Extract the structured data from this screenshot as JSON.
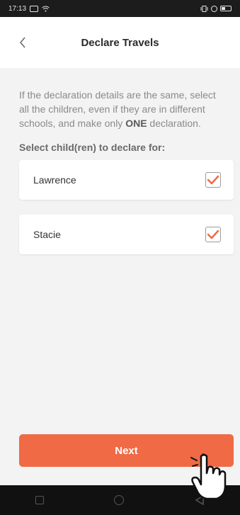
{
  "status_bar": {
    "time": "17:13"
  },
  "header": {
    "title": "Declare Travels"
  },
  "instructions": {
    "text_before": "If the declaration details are the same, select all the children, even if they are in different schools, and make only ",
    "emphasis": "ONE",
    "text_after": " declaration."
  },
  "select_label": "Select child(ren) to declare for:",
  "children": [
    {
      "name": "Lawrence",
      "checked": true
    },
    {
      "name": "Stacie",
      "checked": true
    }
  ],
  "next_button": {
    "label": "Next"
  },
  "colors": {
    "accent": "#ef6a45",
    "background": "#f3f3f3",
    "checkmark": "#ef6a45"
  },
  "icons": {
    "back": "chevron-left-icon",
    "checkbox": "checkbox-checked-icon",
    "cursor": "hand-pointer-icon"
  }
}
